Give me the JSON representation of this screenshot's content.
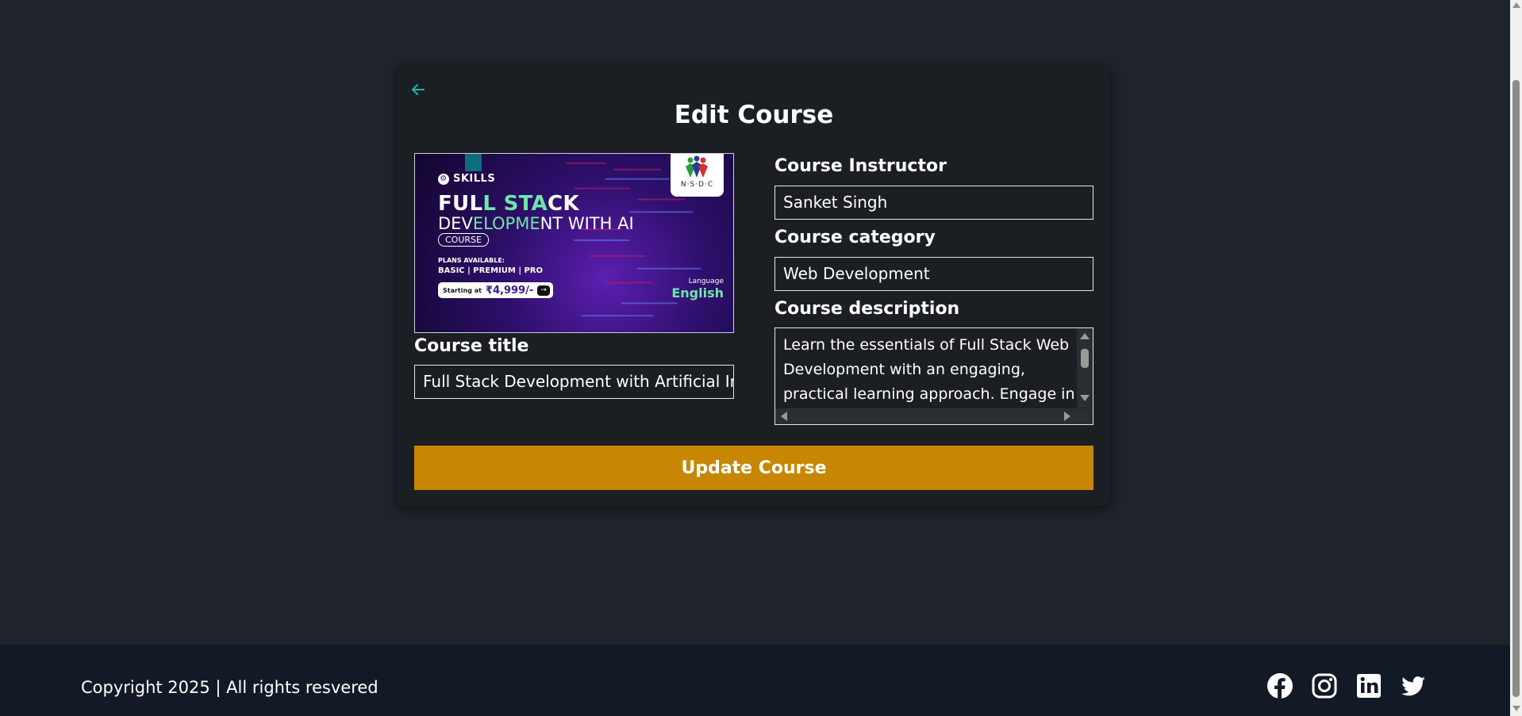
{
  "card": {
    "title": "Edit Course",
    "back_icon": "arrow-left-icon",
    "accent_color": "#1fb6a6"
  },
  "thumbnail": {
    "brand": "SKILLS",
    "headline_1": "FULL STACK",
    "headline_2": "DEVELOPMENT WITH AI",
    "pill": "COURSE",
    "plans_label": "PLANS AVAILABLE:",
    "plans": "BASIC | PREMIUM | PRO",
    "starting_label": "Starting at",
    "price": "₹4,999/-",
    "logo_text": "N·S·D·C",
    "language_label": "Language",
    "language": "English"
  },
  "form": {
    "title_label": "Course title",
    "title_value": "Full Stack Development with Artificial Intel",
    "instructor_label": "Course Instructor",
    "instructor_value": "Sanket Singh",
    "category_label": "Course category",
    "category_value": "Web Development",
    "description_label": "Course description",
    "description_value": "Learn the essentials of Full Stack Web Development with an engaging, practical learning approach. Engage in",
    "submit_label": "Update Course",
    "submit_color": "#c78703"
  },
  "footer": {
    "copyright": "Copyright 2025 | All rights resvered",
    "socials": [
      "facebook-icon",
      "instagram-icon",
      "linkedin-icon",
      "twitter-icon"
    ]
  }
}
